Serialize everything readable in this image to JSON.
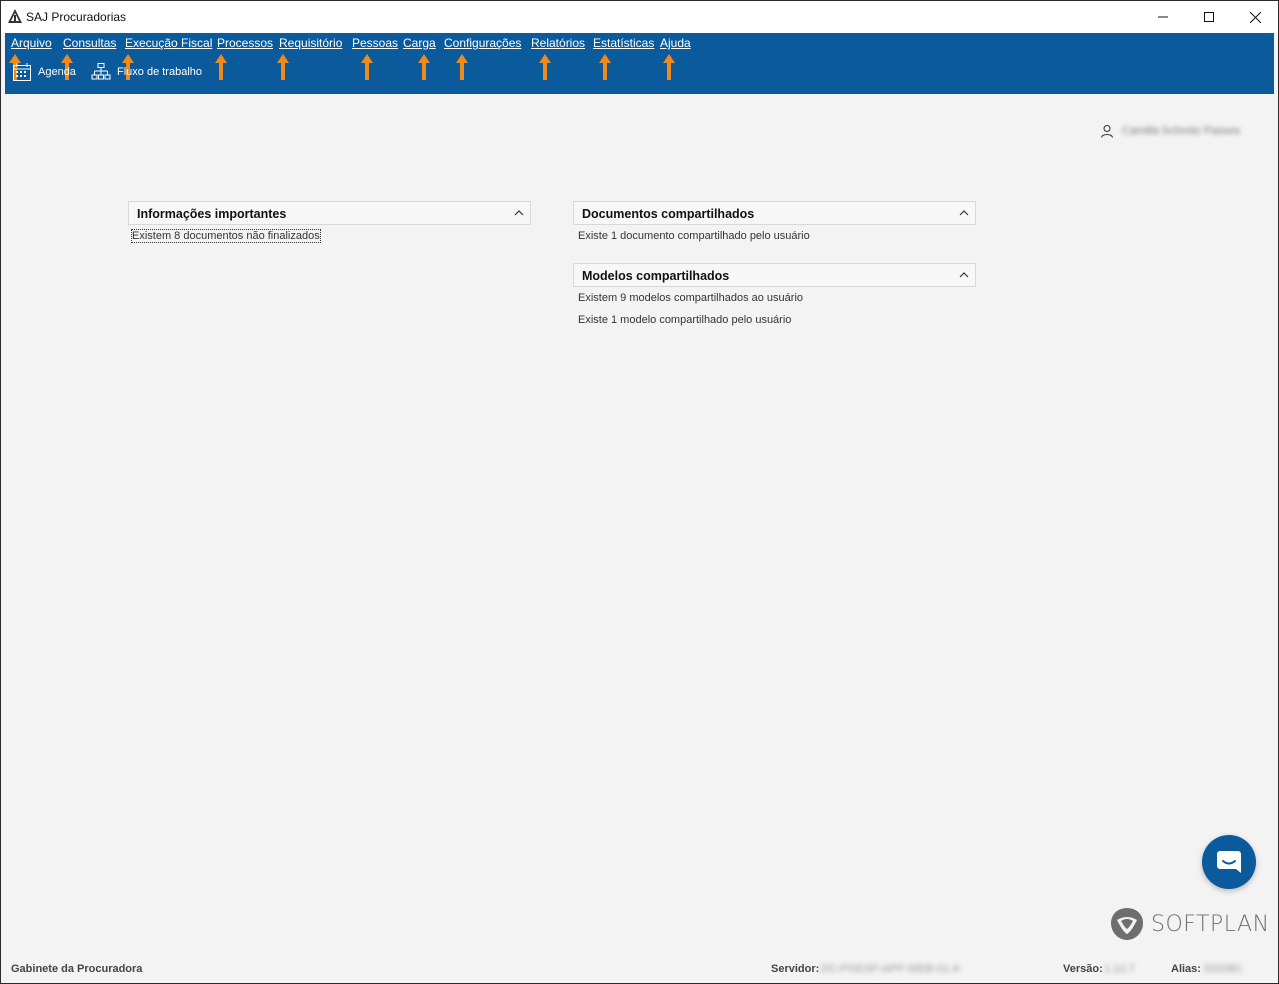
{
  "window": {
    "title": "SAJ Procuradorias"
  },
  "menu": {
    "items": [
      "Arquivo",
      "Consultas",
      "Execução Fiscal",
      "Processos",
      "Requisitório",
      "Pessoas",
      "Carga",
      "Configurações",
      "Relatórios",
      "Estatísticas",
      "Ajuda"
    ]
  },
  "toolbar": {
    "agenda_label": "Agenda",
    "workflow_label": "Fluxo de trabalho"
  },
  "user": {
    "name": "Camilla Schmitz Passos"
  },
  "panels": {
    "info": {
      "title": "Informações importantes",
      "lines": [
        "Existem  8 documentos não finalizados"
      ]
    },
    "docs": {
      "title": "Documentos compartilhados",
      "lines": [
        "Existe 1 documento compartilhado pelo usuário"
      ]
    },
    "models": {
      "title": "Modelos compartilhados",
      "lines": [
        "Existem  9 modelos compartilhados ao usuário",
        "Existe 1 modelo compartilhado pelo usuário"
      ]
    }
  },
  "brand": {
    "name": "SOFTPLAN"
  },
  "status": {
    "office": "Gabinete da Procuradora",
    "server_label": "Servidor:",
    "server_value": "DC-PGESP-APP-WEB-01-A",
    "version_label": "Versão:",
    "version_value": "1.12.7",
    "alias_label": "Alias:",
    "alias_value": "DDDBC"
  },
  "colors": {
    "ribbon": "#0a5a9c",
    "arrow": "#f08a1c",
    "background": "#f3f3f3"
  }
}
